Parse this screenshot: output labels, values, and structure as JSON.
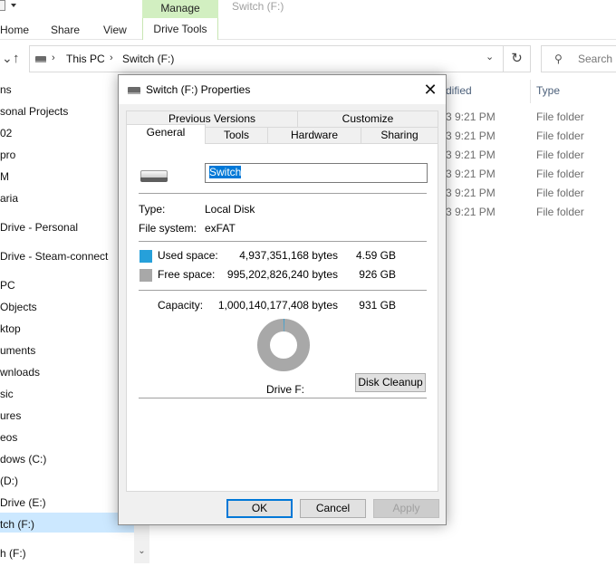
{
  "ribbon": {
    "tabs": [
      "Home",
      "Share",
      "View"
    ],
    "context_group": "Manage",
    "context_tab": "Drive Tools",
    "window_title": "Switch (F:)"
  },
  "address": {
    "segments": [
      "This PC",
      "Switch (F:)"
    ],
    "search_placeholder": "Search S"
  },
  "nav": {
    "items": [
      "ns",
      "sonal Projects",
      "02",
      "pro",
      "M",
      "aria",
      "Drive - Personal",
      "Drive - Steam-connect",
      "PC",
      "Objects",
      "ktop",
      "uments",
      "wnloads",
      "sic",
      "ures",
      "eos",
      "dows (C:)",
      " (D:)",
      "Drive (E:)",
      "tch (F:)",
      "h (F:)"
    ],
    "selected": "tch (F:)"
  },
  "list": {
    "header_date": "dified",
    "header_type": "Type",
    "rows": [
      {
        "date": "3 9:21 PM",
        "type": "File folder"
      },
      {
        "date": "3 9:21 PM",
        "type": "File folder"
      },
      {
        "date": "3 9:21 PM",
        "type": "File folder"
      },
      {
        "date": "3 9:21 PM",
        "type": "File folder"
      },
      {
        "date": "3 9:21 PM",
        "type": "File folder"
      },
      {
        "date": "3 9:21 PM",
        "type": "File folder"
      }
    ]
  },
  "dialog": {
    "title": "Switch (F:) Properties",
    "tabs_back": [
      "Previous Versions",
      "Customize"
    ],
    "tabs_front": [
      "General",
      "Tools",
      "Hardware",
      "Sharing"
    ],
    "active_tab": "General",
    "drive_name": "Switch",
    "type_label": "Type:",
    "type_value": "Local Disk",
    "fs_label": "File system:",
    "fs_value": "exFAT",
    "used_label": "Used space:",
    "used_bytes": "4,937,351,168 bytes",
    "used_gb": "4.59 GB",
    "free_label": "Free space:",
    "free_bytes": "995,202,826,240 bytes",
    "free_gb": "926 GB",
    "capacity_label": "Capacity:",
    "capacity_bytes": "1,000,140,177,408 bytes",
    "capacity_gb": "931 GB",
    "drive_label": "Drive F:",
    "cleanup_label": "Disk Cleanup",
    "used_fraction": 0.0049,
    "colors": {
      "used": "#26a0da",
      "free": "#a8a8a8"
    },
    "buttons": {
      "ok": "OK",
      "cancel": "Cancel",
      "apply": "Apply"
    }
  }
}
